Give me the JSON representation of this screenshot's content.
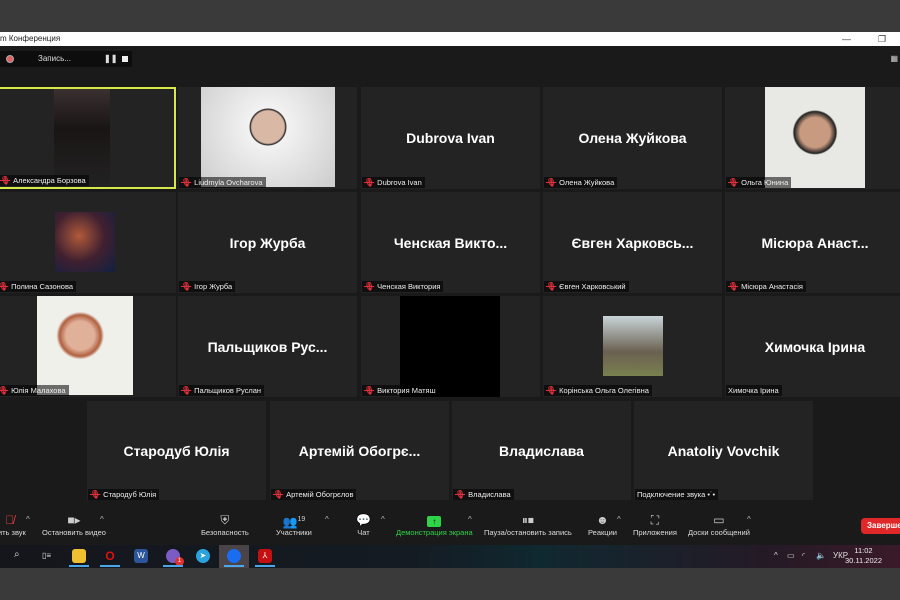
{
  "window": {
    "title": "m Конференция"
  },
  "recording": {
    "label": "Запись..."
  },
  "tiles": [
    {
      "name": "",
      "label": "Александра Борзова",
      "muted": true,
      "kind": "photo",
      "active": true
    },
    {
      "name": "",
      "label": "Liudmyla Ovcharova",
      "muted": true,
      "kind": "photo"
    },
    {
      "name": "Dubrova Ivan",
      "label": "Dubrova Ivan",
      "muted": true,
      "kind": "name"
    },
    {
      "name": "Олена Жуйкова",
      "label": "Олена Жуйкова",
      "muted": true,
      "kind": "name"
    },
    {
      "name": "",
      "label": "Ольга Юнина",
      "muted": true,
      "kind": "photo"
    },
    {
      "name": "",
      "label": "Полина Сазонова",
      "muted": true,
      "kind": "photo"
    },
    {
      "name": "Ігор Журба",
      "label": "Ігор Журба",
      "muted": true,
      "kind": "name"
    },
    {
      "name": "Ченская  Викто...",
      "label": "Ченская Виктория",
      "muted": true,
      "kind": "name"
    },
    {
      "name": "Євген  Харковсь...",
      "label": "Євген Харковський",
      "muted": true,
      "kind": "name"
    },
    {
      "name": "Місюра  Анаст...",
      "label": "Місюра Анастасія",
      "muted": true,
      "kind": "name"
    },
    {
      "name": "",
      "label": "Юлія Малахова",
      "muted": true,
      "kind": "photo"
    },
    {
      "name": "Пальщиков  Рус...",
      "label": "Пальщиков Руслан",
      "muted": true,
      "kind": "name"
    },
    {
      "name": "",
      "label": "Виктория Матяш",
      "muted": true,
      "kind": "black"
    },
    {
      "name": "",
      "label": "Корінська Ольга Олегівна",
      "muted": true,
      "kind": "photo"
    },
    {
      "name": "Химочка Ірина",
      "label": "Химочка Ірина",
      "muted": false,
      "kind": "name"
    },
    {
      "name": "Стародуб Юлія",
      "label": "Стародуб Юлія",
      "muted": true,
      "kind": "name"
    },
    {
      "name": "Артемій  Обогрє...",
      "label": "Артемій Обогрєлов",
      "muted": true,
      "kind": "name"
    },
    {
      "name": "Владислава",
      "label": "Владислава",
      "muted": true,
      "kind": "name"
    },
    {
      "name": "Anatoliy Vovchik",
      "label": "Подключение звука •˙•",
      "muted": false,
      "kind": "name"
    }
  ],
  "toolbar": {
    "mute": "чить звук",
    "video": "Остановить видео",
    "security": "Безопасность",
    "participants": "Участники",
    "participants_count": "19",
    "chat": "Чат",
    "share": "Демонстрация экрана",
    "record": "Пауза/остановить запись",
    "reactions": "Реакции",
    "apps": "Приложения",
    "whiteboards": "Доски сообщений",
    "end": "Завершен"
  },
  "taskbar": {
    "lang": "УКР",
    "time": "11:02",
    "date": "30.11.2022",
    "badge": "1"
  },
  "colors": {
    "accent_green": "#2fd34a",
    "end_red": "#e02828",
    "active_border": "#d6e84a"
  }
}
